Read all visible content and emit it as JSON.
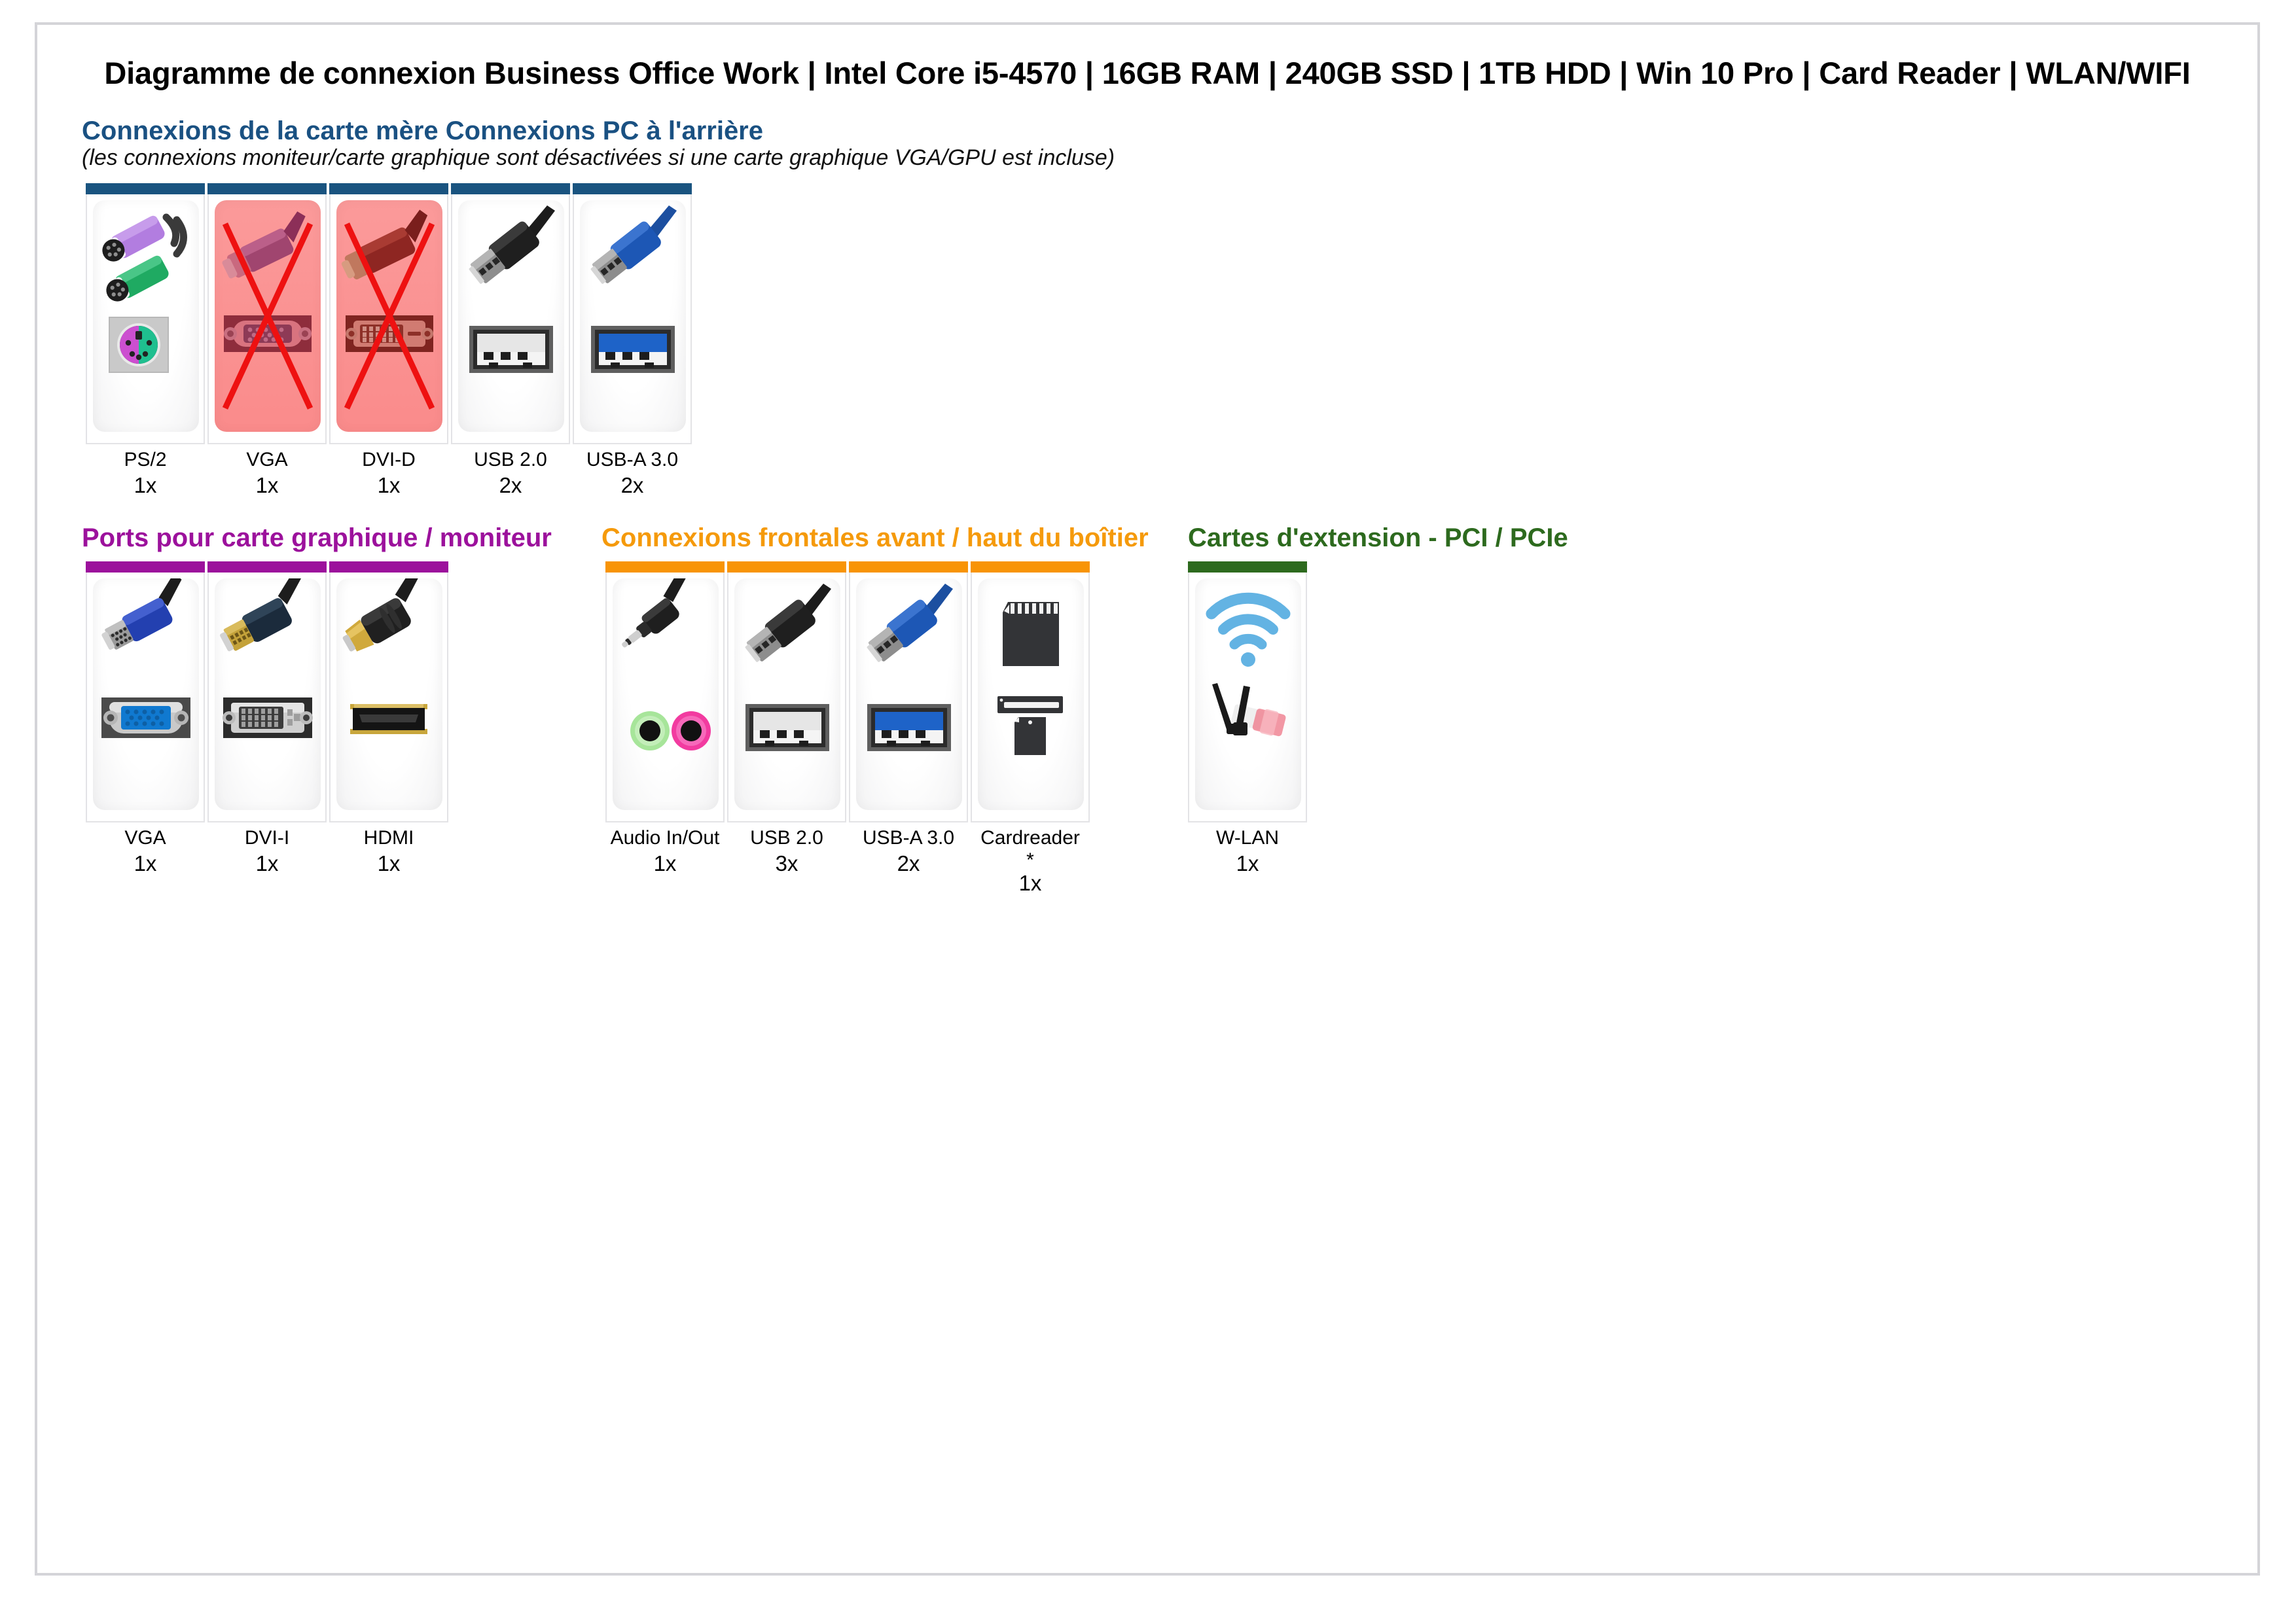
{
  "document": {
    "title": "Diagramme de connexion Business Office Work | Intel Core i5-4570 | 16GB RAM | 240GB SSD | 1TB HDD | Win 10 Pro | Card Reader | WLAN/WIFI"
  },
  "colors": {
    "heading_blue": "#1a5182",
    "heading_purple": "#9c119c",
    "heading_orange": "#f59a0b",
    "heading_green": "#2d6a1e",
    "bar_blue": "#1a5480",
    "bar_purple": "#9c119c",
    "bar_orange": "#f89406",
    "bar_green": "#2d6a1e",
    "disabled_red": "#fa8b8b",
    "cross_red": "#ee1111",
    "page_border": "#d4d4d8"
  },
  "sections": [
    {
      "id": "rear",
      "heading": "Connexions de la carte mère Connexions PC à l'arrière",
      "subheading": "(les connexions moniteur/carte graphique sont désactivées si une carte graphique VGA/GPU est incluse)",
      "accent": "#1a5182",
      "bar": "#1a5480",
      "cards": [
        {
          "label": "PS/2",
          "qty": "1x",
          "icon": "ps2-port-icon",
          "disabled": false,
          "note": null
        },
        {
          "label": "VGA",
          "qty": "1x",
          "icon": "vga-port-icon",
          "disabled": true,
          "note": null
        },
        {
          "label": "DVI-D",
          "qty": "1x",
          "icon": "dvid-port-icon",
          "disabled": true,
          "note": null
        },
        {
          "label": "USB 2.0",
          "qty": "2x",
          "icon": "usb2-port-icon",
          "disabled": false,
          "note": null
        },
        {
          "label": "USB-A 3.0",
          "qty": "2x",
          "icon": "usb3-port-icon",
          "disabled": false,
          "note": null
        }
      ]
    },
    {
      "id": "graphics",
      "heading": "Ports pour carte graphique / moniteur",
      "subheading": null,
      "accent": "#9c119c",
      "bar": "#9c119c",
      "cards": [
        {
          "label": "VGA",
          "qty": "1x",
          "icon": "vga-connector-icon",
          "disabled": false,
          "note": null
        },
        {
          "label": "DVI-I",
          "qty": "1x",
          "icon": "dvii-connector-icon",
          "disabled": false,
          "note": null
        },
        {
          "label": "HDMI",
          "qty": "1x",
          "icon": "hdmi-connector-icon",
          "disabled": false,
          "note": null
        }
      ]
    },
    {
      "id": "front",
      "heading": "Connexions frontales avant / haut du boîtier",
      "subheading": null,
      "accent": "#f59a0b",
      "bar": "#f89406",
      "cards": [
        {
          "label": "Audio In/Out",
          "qty": "1x",
          "icon": "audio-jack-icon",
          "disabled": false,
          "note": null
        },
        {
          "label": "USB 2.0",
          "qty": "3x",
          "icon": "usb2-port-icon",
          "disabled": false,
          "note": null
        },
        {
          "label": "USB-A 3.0",
          "qty": "2x",
          "icon": "usb3-port-icon",
          "disabled": false,
          "note": null
        },
        {
          "label": "Cardreader",
          "qty": "1x",
          "icon": "cardreader-icon",
          "disabled": false,
          "note": "*"
        }
      ]
    },
    {
      "id": "expansion",
      "heading": "Cartes d'extension - PCI / PCIe",
      "subheading": null,
      "accent": "#2d6a1e",
      "bar": "#2d6a1e",
      "cards": [
        {
          "label": "W-LAN",
          "qty": "1x",
          "icon": "wlan-card-icon",
          "disabled": false,
          "note": null
        }
      ]
    }
  ]
}
